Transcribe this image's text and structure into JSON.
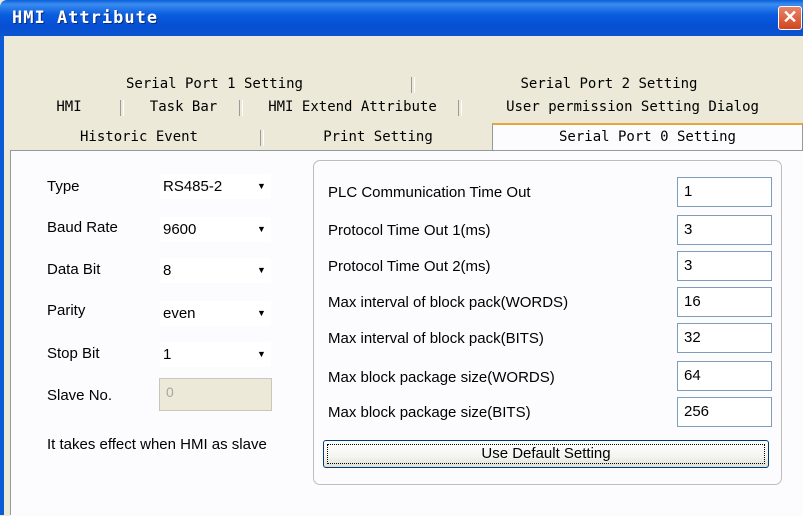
{
  "window": {
    "title": "HMI Attribute",
    "close_glyph": "✕"
  },
  "tabs": {
    "row1": [
      "Serial Port 1 Setting",
      "Serial Port 2 Setting"
    ],
    "row2": [
      "HMI",
      "Task Bar",
      "HMI Extend Attribute",
      "User permission Setting Dialog"
    ],
    "row3": [
      "Historic Event",
      "Print Setting",
      "Serial Port 0 Setting"
    ],
    "active": "Serial Port 0 Setting"
  },
  "left": {
    "type_label": "Type",
    "type_value": "RS485-2",
    "baud_label": "Baud Rate",
    "baud_value": "9600",
    "databit_label": "Data Bit",
    "databit_value": "8",
    "parity_label": "Parity",
    "parity_value": "even",
    "stopbit_label": "Stop Bit",
    "stopbit_value": "1",
    "slave_label": "Slave No.",
    "slave_value": "0",
    "note": "It takes effect when HMI as slave"
  },
  "params": [
    {
      "label": "PLC Communication Time Out",
      "value": "1"
    },
    {
      "label": "Protocol Time Out 1(ms)",
      "value": "3"
    },
    {
      "label": "Protocol Time Out 2(ms)",
      "value": "3"
    },
    {
      "label": "Max interval of block pack(WORDS)",
      "value": "16"
    },
    {
      "label": "Max interval of block pack(BITS)",
      "value": "32"
    },
    {
      "label": "Max block package size(WORDS)",
      "value": "64"
    },
    {
      "label": "Max block package size(BITS)",
      "value": "256"
    }
  ],
  "default_button": "Use Default Setting",
  "icons": {
    "dropdown": "chevron-down-icon",
    "close": "close-icon"
  },
  "colors": {
    "titlebar": "#0b5ddf",
    "close_button": "#d2461d",
    "active_tab_accent": "#e7a63a",
    "dialog_bg": "#ece9d8"
  }
}
